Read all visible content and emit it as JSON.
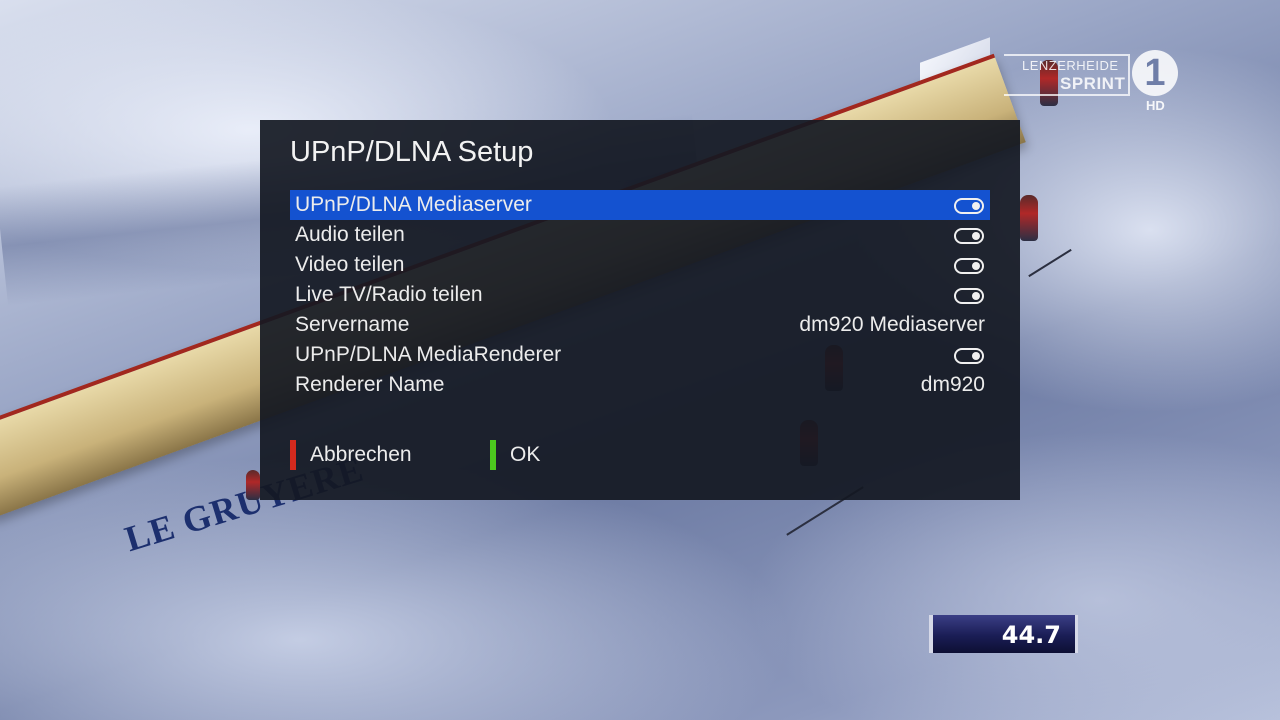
{
  "background": {
    "banner_text": "LE GRUYERE",
    "channel": {
      "event_line1": "LENZERHEIDE",
      "event_line2": "SPRINT",
      "logo_digit": "1",
      "hd_label": "HD"
    },
    "timer": "44.7"
  },
  "dialog": {
    "title": "UPnP/DLNA Setup",
    "items": [
      {
        "label": "UPnP/DLNA Mediaserver",
        "type": "toggle",
        "state": "on",
        "selected": true
      },
      {
        "label": "Audio teilen",
        "type": "toggle",
        "state": "on"
      },
      {
        "label": "Video teilen",
        "type": "toggle",
        "state": "on"
      },
      {
        "label": "Live TV/Radio teilen",
        "type": "toggle",
        "state": "on"
      },
      {
        "label": "Servername",
        "type": "value",
        "value": "dm920 Mediaserver"
      },
      {
        "label": "UPnP/DLNA MediaRenderer",
        "type": "toggle",
        "state": "on"
      },
      {
        "label": "Renderer Name",
        "type": "value",
        "value": "dm920"
      }
    ],
    "buttons": {
      "red": {
        "label": "Abbrechen",
        "color": "#d42a1e"
      },
      "green": {
        "label": "OK",
        "color": "#4cc81e"
      }
    }
  },
  "colors": {
    "selection": "#1452d0",
    "dialog_bg": "#141822"
  }
}
